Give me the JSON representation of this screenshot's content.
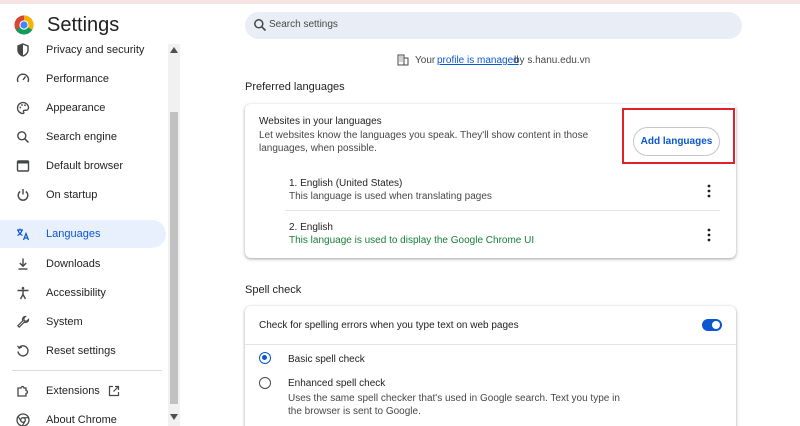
{
  "app": {
    "title": "Settings"
  },
  "search": {
    "placeholder": "Search settings"
  },
  "sidebar": {
    "items": [
      {
        "label": "Privacy and security",
        "icon": "shield-icon"
      },
      {
        "label": "Performance",
        "icon": "speedometer-icon"
      },
      {
        "label": "Appearance",
        "icon": "palette-icon"
      },
      {
        "label": "Search engine",
        "icon": "search-icon"
      },
      {
        "label": "Default browser",
        "icon": "browser-icon"
      },
      {
        "label": "On startup",
        "icon": "power-icon"
      },
      {
        "label": "Languages",
        "icon": "translate-icon",
        "active": true
      },
      {
        "label": "Downloads",
        "icon": "download-icon"
      },
      {
        "label": "Accessibility",
        "icon": "accessibility-icon"
      },
      {
        "label": "System",
        "icon": "wrench-icon"
      },
      {
        "label": "Reset settings",
        "icon": "reset-icon"
      },
      {
        "label": "Extensions",
        "icon": "extensions-icon"
      },
      {
        "label": "About Chrome",
        "icon": "chrome-logo-icon"
      }
    ]
  },
  "managed": {
    "prefix": "Your",
    "link": "profile is managed",
    "suffix": "by s.hanu.edu.vn"
  },
  "languages_section": {
    "title": "Preferred languages",
    "card_title": "Websites in your languages",
    "card_desc": "Let websites know the languages you speak. They'll show content in those languages, when possible.",
    "add_button": "Add languages",
    "languages": [
      {
        "name": "1. English (United States)",
        "note": "This language is used when translating pages"
      },
      {
        "name": "2. English",
        "note": "This language is used to display the Google Chrome UI"
      }
    ]
  },
  "spell_section": {
    "title": "Spell check",
    "toggle_label": "Check for spelling errors when you type text on web pages",
    "toggle_on": true,
    "options": [
      {
        "label": "Basic spell check",
        "checked": true
      },
      {
        "label": "Enhanced spell check",
        "checked": false,
        "desc": "Uses the same spell checker that's used in Google search. Text you type in the browser is sent to Google."
      }
    ]
  },
  "colors": {
    "accent": "#0b57d0",
    "highlight": "#e0212b",
    "active_bg": "#e8f0fe",
    "green_note": "#188038"
  }
}
